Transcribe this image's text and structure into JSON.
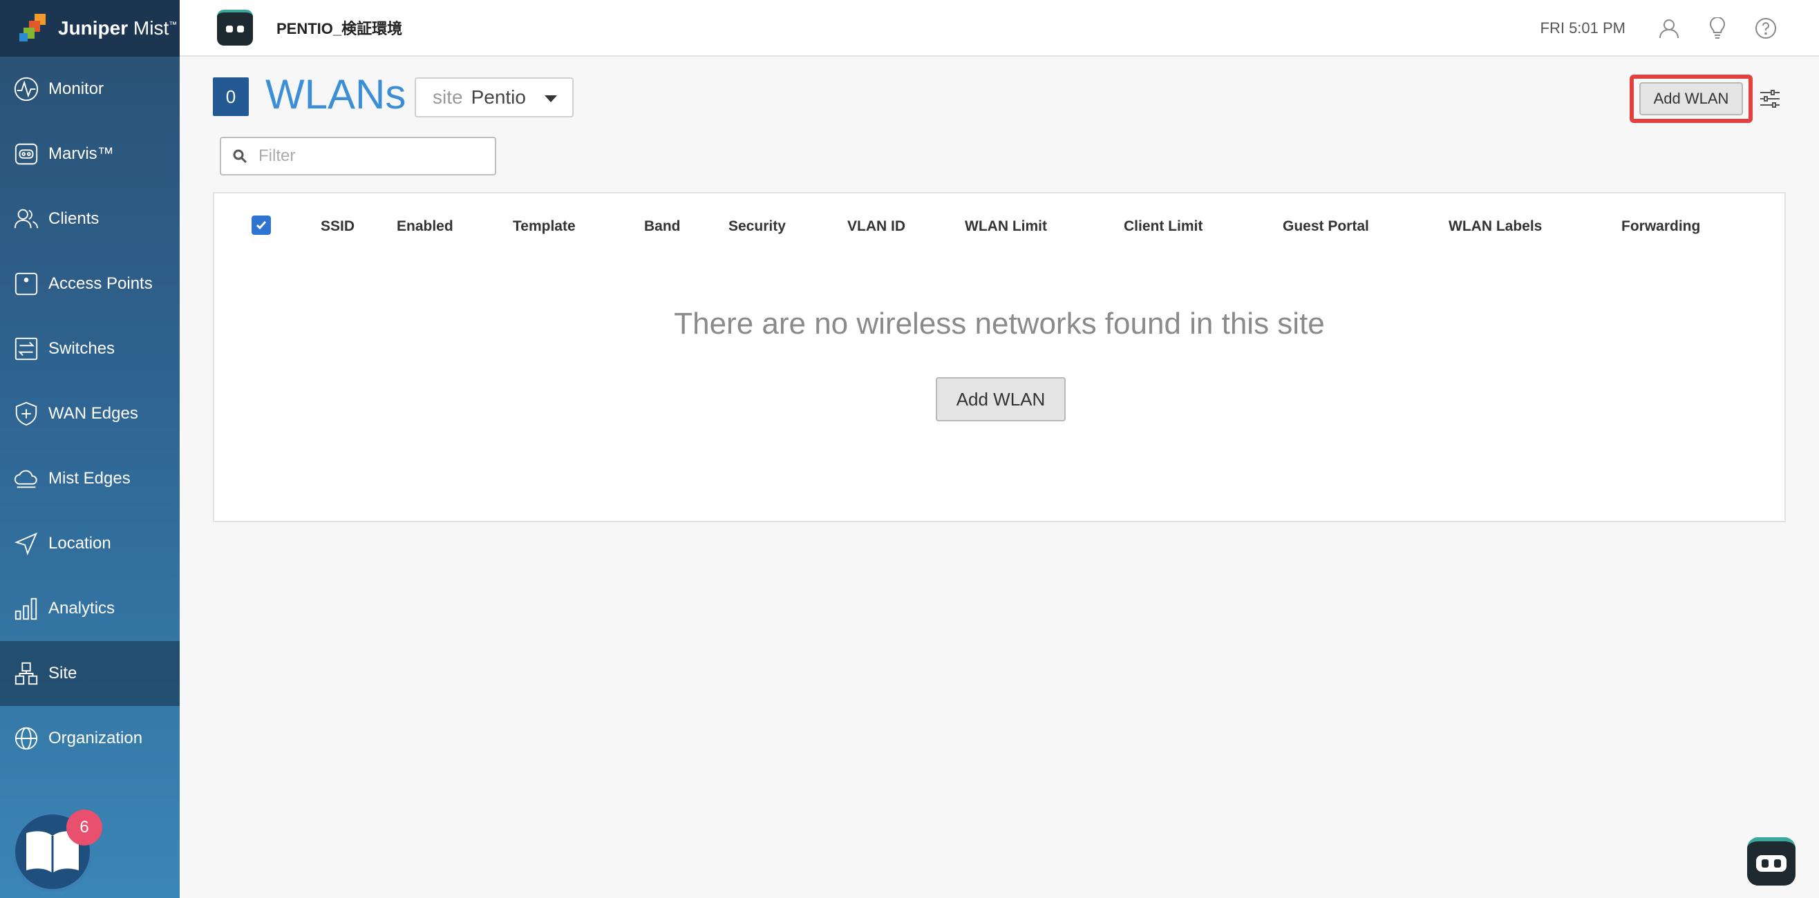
{
  "brand": {
    "name_bold": "Juniper",
    "name_rest": " Mist",
    "tm": "™"
  },
  "header": {
    "org_name": "PENTIO_検証環境",
    "time": "FRI 5:01 PM",
    "icons": [
      "user-icon",
      "lightbulb-icon",
      "help-icon"
    ]
  },
  "sidebar": {
    "items": [
      {
        "label": "Monitor",
        "icon": "monitor-pulse-icon"
      },
      {
        "label": "Marvis™",
        "icon": "marvis-icon"
      },
      {
        "label": "Clients",
        "icon": "clients-icon"
      },
      {
        "label": "Access Points",
        "icon": "access-point-icon"
      },
      {
        "label": "Switches",
        "icon": "switch-icon"
      },
      {
        "label": "WAN Edges",
        "icon": "wan-edge-icon"
      },
      {
        "label": "Mist Edges",
        "icon": "cloud-icon"
      },
      {
        "label": "Location",
        "icon": "location-arrow-icon"
      },
      {
        "label": "Analytics",
        "icon": "bar-chart-icon"
      },
      {
        "label": "Site",
        "icon": "site-icon",
        "active": true
      },
      {
        "label": "Organization",
        "icon": "globe-icon"
      }
    ],
    "guide_badge": "6"
  },
  "page": {
    "count": "0",
    "title": "WLANs",
    "site_label": "site",
    "site_value": "Pentio",
    "add_button": "Add WLAN",
    "filter_placeholder": "Filter"
  },
  "table": {
    "columns": [
      "SSID",
      "Enabled",
      "Template",
      "Band",
      "Security",
      "VLAN ID",
      "WLAN Limit",
      "Client Limit",
      "Guest Portal",
      "WLAN Labels",
      "Forwarding"
    ],
    "empty_message": "There are no wireless networks found in this site",
    "empty_add_button": "Add WLAN"
  },
  "colors": {
    "accent": "#3c8fd6",
    "count_box": "#245a93",
    "highlight": "#e34040",
    "badge": "#e8506e"
  }
}
